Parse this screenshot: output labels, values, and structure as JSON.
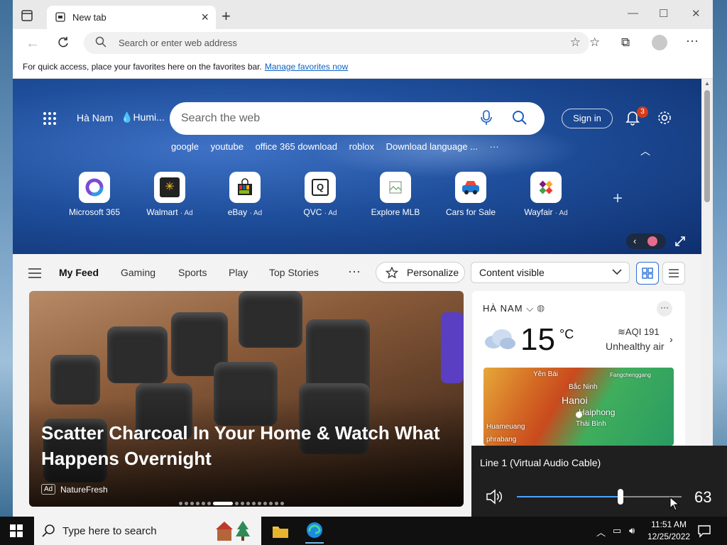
{
  "browser": {
    "tab": {
      "title": "New tab"
    },
    "address_placeholder": "Search or enter web address",
    "favorites_bar": {
      "prompt": "For quick access, place your favorites here on the favorites bar.",
      "link": "Manage favorites now"
    }
  },
  "ntp": {
    "location": "Hà Nam",
    "weather_chip": "Humi...",
    "search_placeholder": "Search the web",
    "sign_in": "Sign in",
    "notification_count": "3",
    "quick_searches": [
      "google",
      "youtube",
      "office 365 download",
      "roblox",
      "Download language ..."
    ],
    "tiles": [
      {
        "label": "Microsoft 365",
        "ad": ""
      },
      {
        "label": "Walmart",
        "ad": "· Ad"
      },
      {
        "label": "eBay",
        "ad": "· Ad"
      },
      {
        "label": "QVC",
        "ad": "· Ad"
      },
      {
        "label": "Explore MLB",
        "ad": ""
      },
      {
        "label": "Cars for Sale",
        "ad": ""
      },
      {
        "label": "Wayfair",
        "ad": "· Ad"
      }
    ]
  },
  "feed": {
    "tabs": [
      "My Feed",
      "Gaming",
      "Sports",
      "Play",
      "Top Stories"
    ],
    "personalize": "Personalize",
    "content_visibility": "Content visible",
    "hero": {
      "title": "Scatter Charcoal In Your Home & Watch What Happens Overnight",
      "ad_badge": "Ad",
      "source": "NatureFresh",
      "slide_count": 16,
      "active_slide": 6
    }
  },
  "weather": {
    "location": "HÀ NAM",
    "temperature": "15",
    "unit": "°C",
    "aqi": "AQI 191",
    "aqi_status": "Unhealthy air",
    "map_labels": [
      "Yên Bái",
      "Fangchenggang",
      "Bắc Ninh",
      "Hanoi",
      "Haiphong",
      "Thái Bình",
      "Huameuang",
      "phrabang"
    ]
  },
  "volume": {
    "device": "Line 1 (Virtual Audio Cable)",
    "level": 63,
    "level_fraction": 0.63
  },
  "taskbar": {
    "search_placeholder": "Type here to search",
    "time": "11:51 AM",
    "date": "12/25/2022"
  },
  "colors": {
    "accent": "#2b6fd6",
    "hero_bg": "#1f4f9c",
    "taskbar": "#101010"
  }
}
